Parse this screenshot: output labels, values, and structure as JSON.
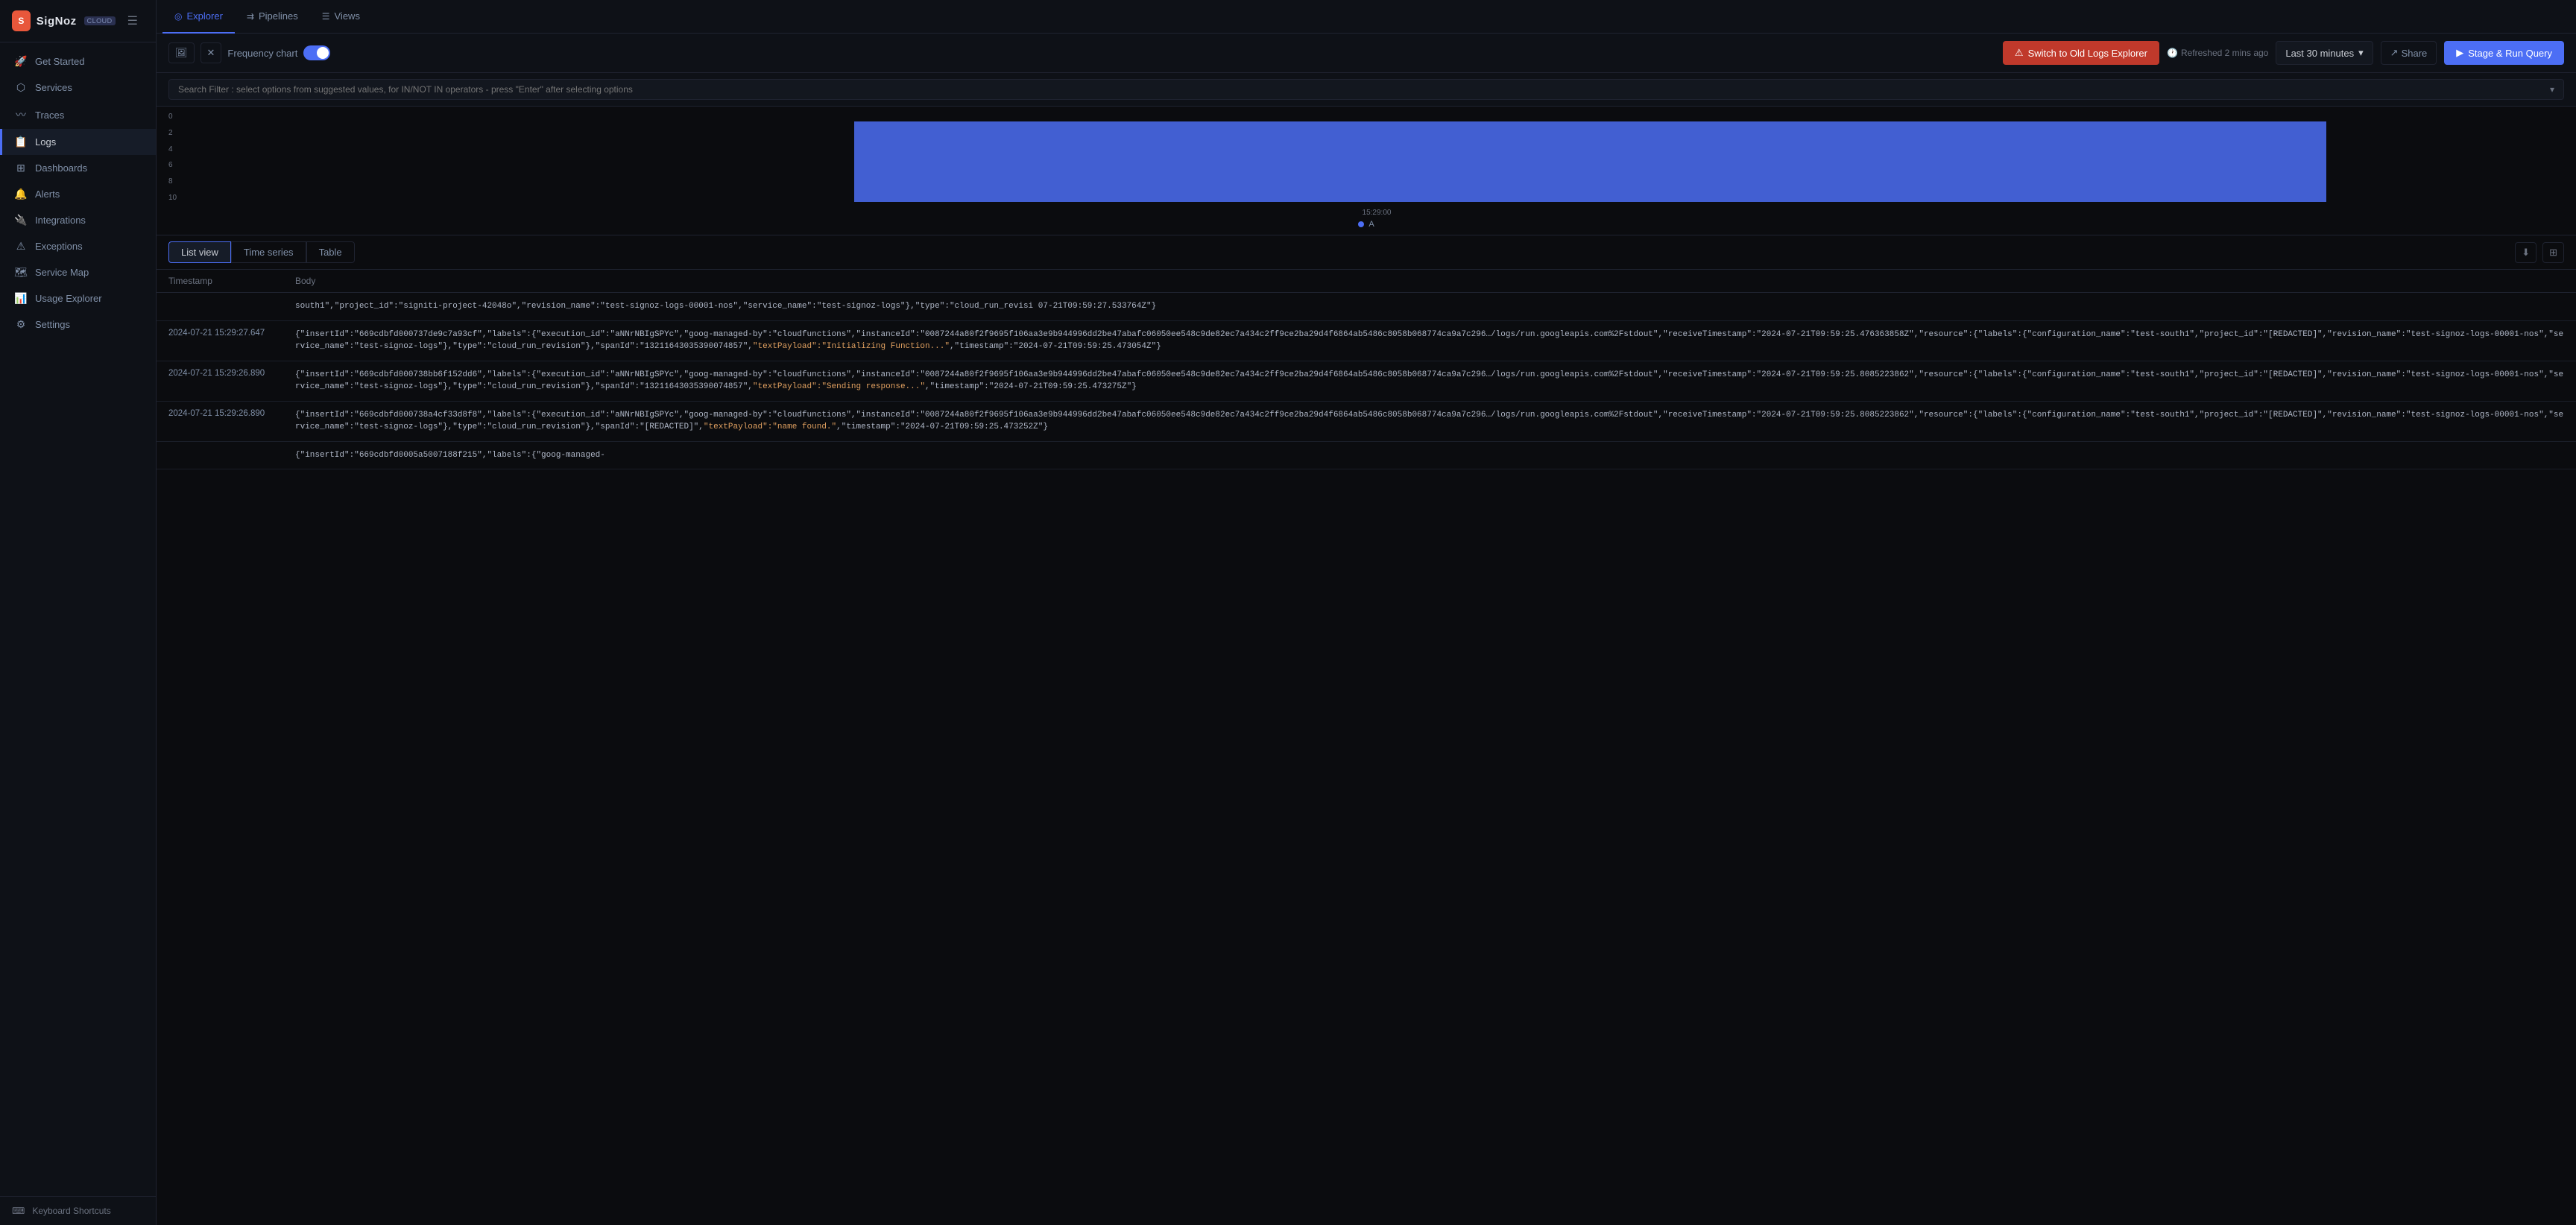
{
  "brand": {
    "logo_text": "SigNoz",
    "logo_badge": "CLOUD",
    "logo_initials": "S"
  },
  "sidebar": {
    "items": [
      {
        "id": "get-started",
        "label": "Get Started",
        "icon": "🚀"
      },
      {
        "id": "services",
        "label": "Services",
        "icon": "⬡"
      },
      {
        "id": "traces",
        "label": "Traces",
        "icon": "〰"
      },
      {
        "id": "logs",
        "label": "Logs",
        "icon": "📋"
      },
      {
        "id": "dashboards",
        "label": "Dashboards",
        "icon": "⊞"
      },
      {
        "id": "alerts",
        "label": "Alerts",
        "icon": "🔔"
      },
      {
        "id": "integrations",
        "label": "Integrations",
        "icon": "🔌"
      },
      {
        "id": "exceptions",
        "label": "Exceptions",
        "icon": "⚠"
      },
      {
        "id": "service-map",
        "label": "Service Map",
        "icon": "🗺"
      },
      {
        "id": "usage-explorer",
        "label": "Usage Explorer",
        "icon": "📊"
      },
      {
        "id": "settings",
        "label": "Settings",
        "icon": "⚙"
      }
    ],
    "active": "logs",
    "footer": {
      "label": "Keyboard Shortcuts",
      "icon": "⌨"
    }
  },
  "top_nav": {
    "tabs": [
      {
        "id": "explorer",
        "label": "Explorer",
        "icon": "◎",
        "active": true
      },
      {
        "id": "pipelines",
        "label": "Pipelines",
        "icon": "⇉"
      },
      {
        "id": "views",
        "label": "Views",
        "icon": "☰"
      }
    ]
  },
  "toolbar": {
    "icons": [
      "🖼",
      "✕"
    ],
    "freq_chart_label": "Frequency chart",
    "switch_old_btn": "Switch to Old Logs Explorer",
    "refreshed_text": "Refreshed 2 mins ago",
    "time_range_label": "Last 30 minutes",
    "share_label": "Share",
    "stage_run_label": "Stage & Run Query"
  },
  "search": {
    "placeholder": "Search Filter : select options from suggested values, for IN/NOT IN operators - press \"Enter\" after selecting options"
  },
  "chart": {
    "y_labels": [
      "0",
      "2",
      "4",
      "6",
      "8",
      "10"
    ],
    "timestamp": "15:29:00",
    "legend_label": "A",
    "bar_start_pct": 28,
    "bar_width_pct": 62,
    "bar_height_pct": 100
  },
  "list_controls": {
    "view_tabs": [
      {
        "id": "list-view",
        "label": "List view",
        "active": true
      },
      {
        "id": "time-series",
        "label": "Time series",
        "active": false
      },
      {
        "id": "table",
        "label": "Table",
        "active": false
      }
    ]
  },
  "table": {
    "headers": [
      "Timestamp",
      "Body"
    ],
    "rows": [
      {
        "timestamp": "",
        "body": "south1\",\"project_id\":\"signiti-project-42048o\",\"revision_name\":\"test-signoz-logs-00001-nos\",\"service_name\":\"test-signoz-logs\"},\"type\":\"cloud_run_revisi 07-21T09:59:27.533764Z\"}"
      },
      {
        "timestamp": "2024-07-21 15:29:27.647",
        "body": "{\"insertId\":\"669cdbfd000737de9c7a93cf\",\"labels\":{\"execution_id\":\"aNNrNBIgSPYc\",\"goog-managed-by\":\"cloudfunctions\",\"instanceId\":\"0087244a80f2f9695f106aa3e9b944996dd2be47abafc06050ee548c9de82ec7a434c2ff9ce2ba29d4f6864ab5486c8058b068774ca9a7c296…/logs/run.googleapis.com%2Fstdout\",\"receiveTimestamp\":\"2024-07-21T09:59:25.476363858Z\",\"resource\":{\"labels\":{\"configuration_name\":\"test-south1\",\"project_id\":\"[REDACTED]\",\"revision_name\":\"test-signoz-logs-00001-nos\",\"service_name\":\"test-signoz-logs\"},\"type\":\"cloud_run_revision\"},\"spanId\":\"13211643035390074857\",\"textPayload\":\"Initializing Function...\",\"timestamp\":\"2024-07-21T09:59:25.473054Z\"}"
      },
      {
        "timestamp": "2024-07-21 15:29:26.890",
        "body": "{\"insertId\":\"669cdbfd000738bb6f152dd6\",\"labels\":{\"execution_id\":\"aNNrNBIgSPYc\",\"goog-managed-by\":\"cloudfunctions\",\"instanceId\":\"0087244a80f2f9695f106aa3e9b944996dd2be47abafc06050ee548c9de82ec7a434c2ff9ce2ba29d4f6864ab5486c8058b068774ca9a7c296…/logs/run.googleapis.com%2Fstdout\",\"receiveTimestamp\":\"2024-07-21T09:59:25.8085223862\",\"resource\":{\"labels\":{\"configuration_name\":\"test-south1\",\"project_id\":\"[REDACTED]\",\"revision_name\":\"test-signoz-logs-00001-nos\",\"service_name\":\"test-signoz-logs\"},\"type\":\"cloud_run_revision\"},\"spanId\":\"13211643035390074857\",\"textPayload\":\"Sending response...\",\"timestamp\":\"2024-07-21T09:59:25.473275Z\"}"
      },
      {
        "timestamp": "2024-07-21 15:29:26.890",
        "body": "{\"insertId\":\"669cdbfd000738a4cf33d8f8\",\"labels\":{\"execution_id\":\"aNNrNBIgSPYc\",\"goog-managed-by\":\"cloudfunctions\",\"instanceId\":\"0087244a80f2f9695f106aa3e9b944996dd2be47abafc06050ee548c9de82ec7a434c2ff9ce2ba29d4f6864ab5486c8058b068774ca9a7c296…/logs/run.googleapis.com%2Fstdout\",\"receiveTimestamp\":\"2024-07-21T09:59:25.8085223862\",\"resource\":{\"labels\":{\"configuration_name\":\"test-south1\",\"project_id\":\"[REDACTED]\",\"revision_name\":\"test-signoz-logs-00001-nos\",\"service_name\":\"test-signoz-logs\"},\"type\":\"cloud_run_revision\"},\"spanId\":\"[REDACTED]\",\"textPayload\":\"name found.\",\"timestamp\":\"2024-07-21T09:59:25.473252Z\"}"
      },
      {
        "timestamp": "",
        "body": "{\"insertId\":\"669cdbfd0005a5007188f215\",\"labels\":{\"goog-managed-"
      }
    ]
  }
}
